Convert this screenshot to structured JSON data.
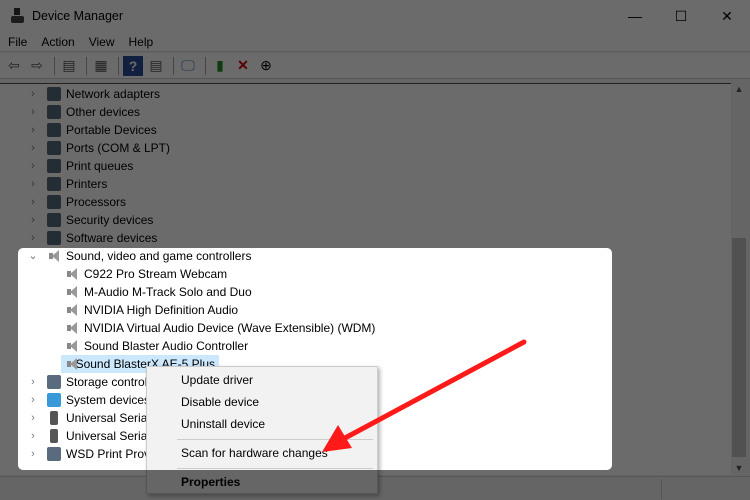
{
  "window": {
    "title": "Device Manager",
    "minimize": "—",
    "maximize": "☐",
    "close": "✕"
  },
  "menu": [
    "File",
    "Action",
    "View",
    "Help"
  ],
  "toolbar": {
    "icons": [
      "back-icon",
      "forward-icon",
      "show-hide-console-tree-icon",
      "properties-icon",
      "help-icon",
      "action-pane-icon",
      "scan-hardware-icon",
      "update-driver-icon",
      "uninstall-icon",
      "disable-icon"
    ]
  },
  "tree": {
    "before": [
      "Network adapters",
      "Other devices",
      "Portable Devices",
      "Ports (COM & LPT)",
      "Print queues",
      "Printers",
      "Processors",
      "Security devices",
      "Software devices"
    ],
    "expanded": "Sound, video and game controllers",
    "children": [
      "C922 Pro Stream Webcam",
      "M-Audio M-Track Solo and Duo",
      "NVIDIA High Definition Audio",
      "NVIDIA Virtual Audio Device (Wave Extensible) (WDM)",
      "Sound Blaster Audio Controller",
      "Sound BlasterX AE-5 Plus"
    ],
    "after": [
      "Storage controllers",
      "System devices",
      "Universal Serial Bus controllers",
      "Universal Serial Bus devices",
      "WSD Print Provider"
    ]
  },
  "context_menu": {
    "items": [
      "Update driver",
      "Disable device",
      "Uninstall device",
      "Scan for hardware changes",
      "Properties"
    ]
  },
  "colors": {
    "annotation_arrow": "#ff1a1a",
    "selection": "#cce8ff"
  }
}
